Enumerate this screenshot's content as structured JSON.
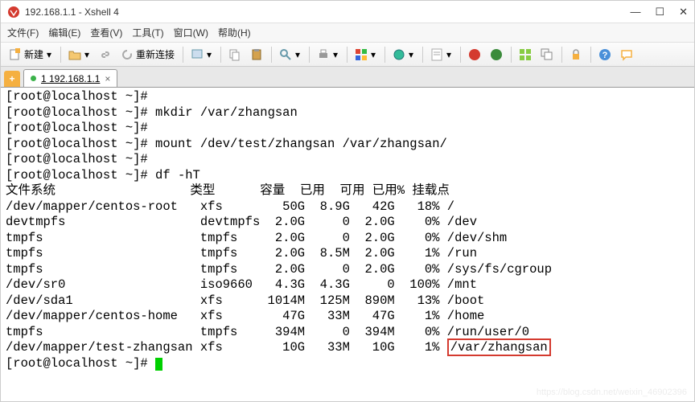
{
  "window": {
    "title": "192.168.1.1 - Xshell 4"
  },
  "menu": {
    "file": "文件(F)",
    "edit": "编辑(E)",
    "view": "查看(V)",
    "tools": "工具(T)",
    "window": "窗口(W)",
    "help": "帮助(H)"
  },
  "toolbar": {
    "new_label": "新建",
    "reconnect_label": "重新连接"
  },
  "tab": {
    "label": "1 192.168.1.1"
  },
  "prompt": "[root@localhost ~]#",
  "cmds": {
    "mkdir": "mkdir /var/zhangsan",
    "mount": "mount /dev/test/zhangsan /var/zhangsan/",
    "df": "df -hT"
  },
  "df_header": "文件系统                  类型      容量  已用  可用 已用% 挂载点",
  "df_rows": [
    "/dev/mapper/centos-root   xfs        50G  8.9G   42G   18% /",
    "devtmpfs                  devtmpfs  2.0G     0  2.0G    0% /dev",
    "tmpfs                     tmpfs     2.0G     0  2.0G    0% /dev/shm",
    "tmpfs                     tmpfs     2.0G  8.5M  2.0G    1% /run",
    "tmpfs                     tmpfs     2.0G     0  2.0G    0% /sys/fs/cgroup",
    "/dev/sr0                  iso9660   4.3G  4.3G     0  100% /mnt",
    "/dev/sda1                 xfs      1014M  125M  890M   13% /boot",
    "/dev/mapper/centos-home   xfs        47G   33M   47G    1% /home",
    "tmpfs                     tmpfs     394M     0  394M    0% /run/user/0"
  ],
  "df_last": {
    "pre": "/dev/mapper/test-zhangsan xfs        10G   33M   10G    1% ",
    "mount": "/var/zhangsan"
  },
  "watermark": "https://blog.csdn.net/weixin_46902396"
}
